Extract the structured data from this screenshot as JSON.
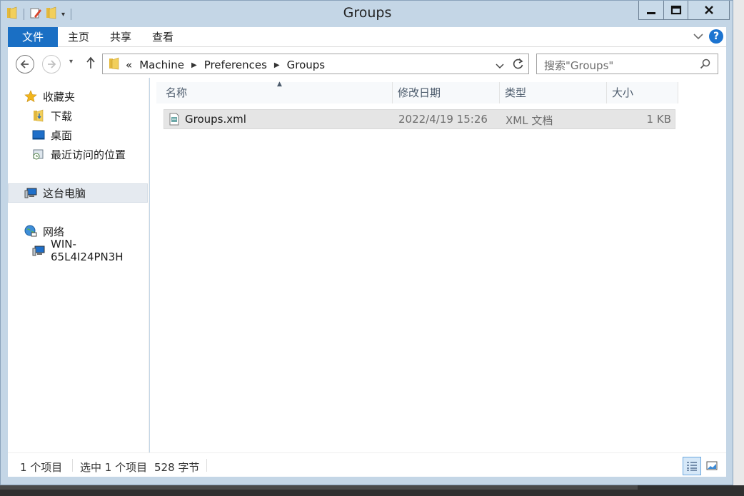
{
  "window": {
    "title": "Groups"
  },
  "ribbon": {
    "tabs": [
      "文件",
      "主页",
      "共享",
      "查看"
    ]
  },
  "address": {
    "overflow": "«",
    "crumbs": [
      "Machine",
      "Preferences",
      "Groups"
    ]
  },
  "search": {
    "placeholder": "搜索\"Groups\""
  },
  "nav": {
    "favorites": "收藏夹",
    "downloads": "下载",
    "desktop": "桌面",
    "recent": "最近访问的位置",
    "thispc": "这台电脑",
    "network": "网络",
    "computer": "WIN-65L4I24PN3H"
  },
  "columns": {
    "name": "名称",
    "modified": "修改日期",
    "type": "类型",
    "size": "大小"
  },
  "files": [
    {
      "name": "Groups.xml",
      "modified": "2022/4/19 15:26",
      "type": "XML 文档",
      "size": "1 KB"
    }
  ],
  "status": {
    "count": "1 个项目",
    "selected": "选中 1 个项目",
    "bytes": "528 字节"
  },
  "icons": {
    "folder": "folder-icon",
    "back": "back-arrow-icon",
    "forward": "forward-arrow-icon",
    "up": "up-arrow-icon",
    "refresh": "refresh-icon",
    "search": "search-icon",
    "help": "help-icon",
    "star": "star-icon",
    "xml": "xml-document-icon"
  },
  "colors": {
    "accent": "#1a6fc4",
    "frame": "#c4d6e6",
    "selected_row": "#e5e5e5"
  }
}
